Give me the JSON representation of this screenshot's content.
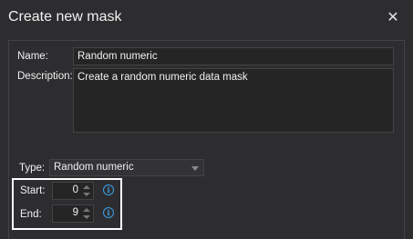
{
  "window": {
    "title": "Create new mask",
    "close_glyph": "✕"
  },
  "form": {
    "name_label": "Name:",
    "name_value": "Random numeric",
    "description_label": "Description:",
    "description_value": "Create a random numeric data mask",
    "type_label": "Type:",
    "type_value": "Random numeric",
    "start_label": "Start:",
    "start_value": "0",
    "end_label": "End:",
    "end_value": "9",
    "info_glyph": "i"
  },
  "colors": {
    "background": "#2d2d30",
    "border": "#434346",
    "info": "#3a9fe6",
    "highlight": "#ffffff"
  }
}
